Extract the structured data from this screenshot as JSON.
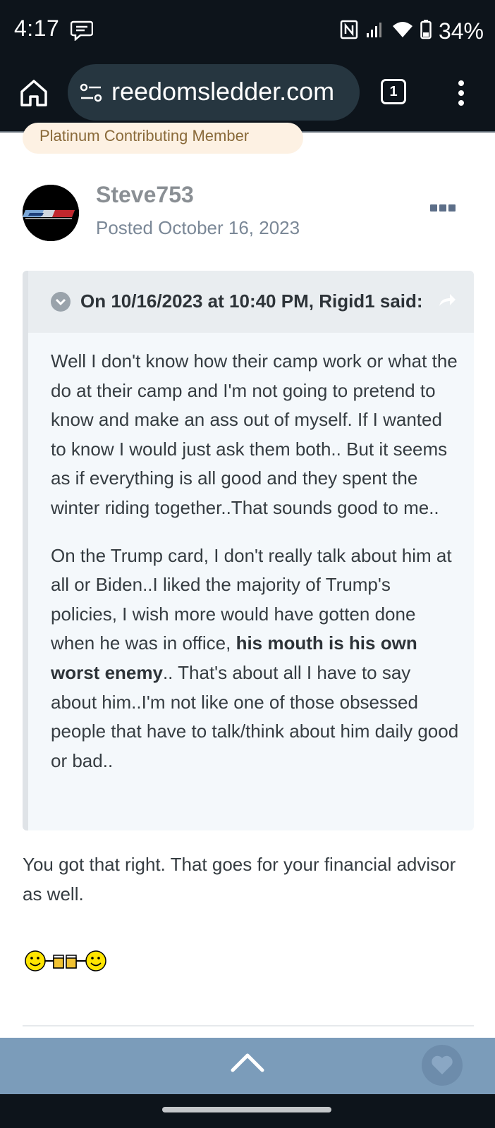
{
  "status_bar": {
    "time": "4:17",
    "battery": "34%",
    "icons": [
      "message-icon",
      "nfc-icon",
      "signal-icon",
      "wifi-icon",
      "battery-icon"
    ]
  },
  "browser": {
    "url": "reedomsledder.com",
    "tab_count": "1",
    "icons": [
      "home-icon",
      "site-settings-icon",
      "tabs-icon",
      "overflow-menu-icon"
    ]
  },
  "post": {
    "badge": "Platinum Contributing Member",
    "author": "Steve753",
    "date": "Posted October 16, 2023",
    "quote": {
      "citation": "On 10/16/2023 at 10:40 PM, Rigid1 said:",
      "paragraph_1": "Well I don't know how their camp work or what the do at their camp and I'm not going to pretend to know and make an ass out of myself. If I wanted to know I would just ask them both.. But it seems as if everything is all good and they spent the winter riding together..That sounds good to me..",
      "paragraph_2_before": "On the Trump card, I don't really talk about him at all or Biden..I liked the majority of Trump's policies, I wish more would have gotten done when he was in office, ",
      "paragraph_2_bold": "his mouth is his own worst enemy",
      "paragraph_2_after": ".. That's about all I have to say about him..I'm not like one of those obsessed people that have to talk/think about him daily good or bad.."
    },
    "reply": "You got that right. That goes for your financial advisor as well."
  },
  "colors": {
    "status_bg": "#0d141b",
    "url_pill": "#263640",
    "quote_bg": "#f4f8fb",
    "bottom_bar": "#7b9cba",
    "badge_bg": "#fdf1e3"
  }
}
